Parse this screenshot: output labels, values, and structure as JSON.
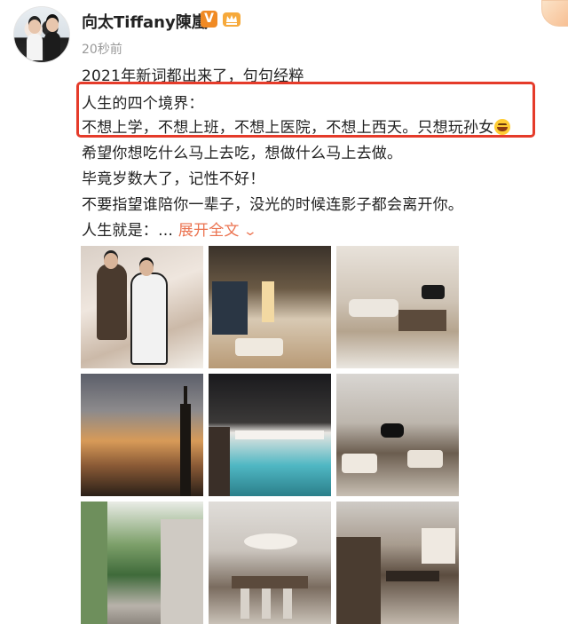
{
  "post": {
    "username": "向太Tiffany陳嵐",
    "verified_badge": "V",
    "timestamp": "20秒前",
    "lines": [
      "2021年新词都出来了，句句经粹",
      "人生的四个境界：",
      "不想上学，不想上班，不想上医院，不想上西天。只想玩孙女",
      "希望你想吃什么马上去吃，想做什么马上去做。",
      "毕竟岁数大了，记性不好！",
      "不要指望谁陪你一辈子，没光的时候连影子都会离开你。"
    ],
    "last_line_prefix": "人生就是：…",
    "expand_label": "展开全文",
    "emoji_name": "laughing-emoji-icon"
  },
  "colors": {
    "accent_orange": "#eb7350",
    "highlight_red": "#e53b2a",
    "badge_orange": "#f08a24",
    "timestamp_gray": "#999999"
  },
  "photos": [
    {
      "name": "photo-couple-living-room"
    },
    {
      "name": "photo-city-view-room"
    },
    {
      "name": "photo-living-room-piano"
    },
    {
      "name": "photo-taipei-101-sunset"
    },
    {
      "name": "photo-rooftop-pool"
    },
    {
      "name": "photo-lounge-piano"
    },
    {
      "name": "photo-garden-corridor"
    },
    {
      "name": "photo-dining-chandelier"
    },
    {
      "name": "photo-dining-room"
    }
  ]
}
